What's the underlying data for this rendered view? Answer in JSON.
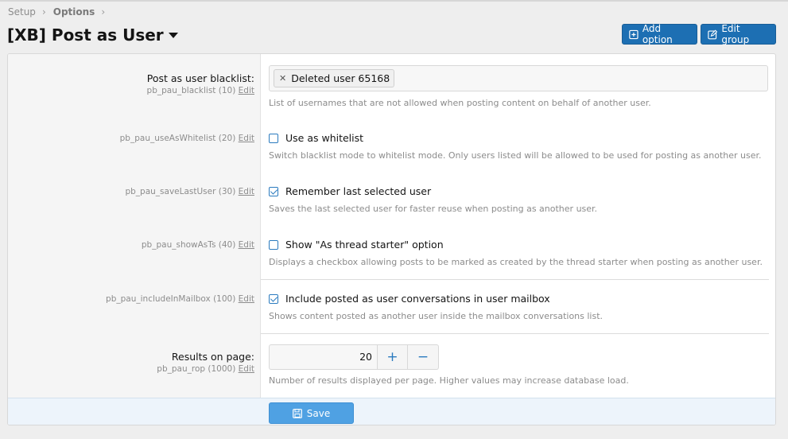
{
  "breadcrumb": {
    "items": [
      "Setup",
      "Options"
    ]
  },
  "page": {
    "title": "[XB] Post as User"
  },
  "header_buttons": {
    "add_option": "Add option",
    "edit_group": "Edit group"
  },
  "edit_label": "Edit",
  "options": {
    "blacklist": {
      "label": "Post as user blacklist:",
      "key": "pb_pau_blacklist (10)",
      "token": "Deleted user 65168",
      "explain": "List of usernames that are not allowed when posting content on behalf of another user."
    },
    "whitelist": {
      "key": "pb_pau_useAsWhitelist (20)",
      "checkbox_label": "Use as whitelist",
      "checked": false,
      "explain": "Switch blacklist mode to whitelist mode. Only users listed will be allowed to be used for posting as another user."
    },
    "save_last": {
      "key": "pb_pau_saveLastUser (30)",
      "checkbox_label": "Remember last selected user",
      "checked": true,
      "explain": "Saves the last selected user for faster reuse when posting as another user."
    },
    "show_ast": {
      "key": "pb_pau_showAsTs (40)",
      "checkbox_label": "Show \"As thread starter\" option",
      "checked": false,
      "explain": "Displays a checkbox allowing posts to be marked as created by the thread starter when posting as another user."
    },
    "mailbox": {
      "key": "pb_pau_includeInMailbox (100)",
      "checkbox_label": "Include posted as user conversations in user mailbox",
      "checked": true,
      "explain": "Shows content posted as another user inside the mailbox conversations list."
    },
    "results": {
      "label": "Results on page:",
      "key": "pb_pau_rop (1000)",
      "value": "20",
      "plus": "+",
      "minus": "−",
      "explain": "Number of results displayed per page. Higher values may increase database load."
    }
  },
  "footer": {
    "save_label": "Save"
  },
  "colors": {
    "primary": "#1d6fb3",
    "save": "#4fa1e3",
    "footer_bg": "#edf4fb"
  }
}
